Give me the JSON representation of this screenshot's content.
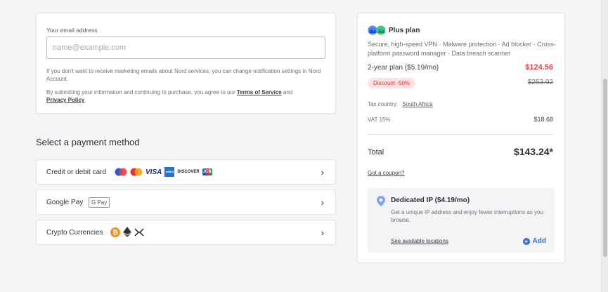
{
  "email": {
    "label": "Your email address",
    "placeholder": "name@example.com",
    "value": "",
    "marketing_note": "If you don't want to receive marketing emails about Nord services, you can change notification settings in Nord Account.",
    "terms_prefix": "By submitting your information and continuing to purchase, you agree to our ",
    "terms_link": "Terms of Service",
    "terms_and": " and ",
    "privacy_link": "Privacy Policy",
    "terms_suffix": "."
  },
  "payment": {
    "title": "Select a payment method",
    "methods": [
      {
        "label": "Credit or debit card",
        "icons": [
          "maestro-icon",
          "mastercard-icon",
          "visa-icon",
          "amex-icon",
          "discover-icon",
          "jcb-icon"
        ]
      },
      {
        "label": "Google Pay",
        "icons": [
          "google-pay-icon"
        ]
      },
      {
        "label": "Crypto Currencies",
        "icons": [
          "bitcoin-icon",
          "ethereum-icon",
          "xrp-icon"
        ]
      }
    ],
    "visa_text": "VISA",
    "amex_text": "AMEX",
    "discover_text": "DISCOVER",
    "jcb_text": "JCB",
    "gpay_text": "G Pay",
    "btc_text": "₿"
  },
  "summary": {
    "plan_name": "Plus plan",
    "plan_features": "Secure, high-speed VPN · Malware protection · Ad blocker · Cross-platform password manager · Data breach scanner",
    "term_label": "2-year plan ($5.19/mo)",
    "price": "$124.56",
    "discount_badge": "Discount -50%",
    "original_price": "$253.92",
    "tax_country_label": "Tax country:",
    "tax_country": "South Africa",
    "vat_label": "VAT 15%",
    "vat_value": "$18.68",
    "total_label": "Total",
    "total_value": "$143.24*",
    "coupon_link": "Got a coupon?",
    "dedicated_ip": {
      "title": "Dedicated IP ($4.19/mo)",
      "description": "Get a unique IP address and enjoy fewer interruptions as you browse.",
      "locations_link": "See available locations",
      "add_label": "Add"
    }
  },
  "colors": {
    "price_red": "#e5484d",
    "link_blue": "#2d6ee0",
    "badge_bg": "#fde2e3"
  }
}
